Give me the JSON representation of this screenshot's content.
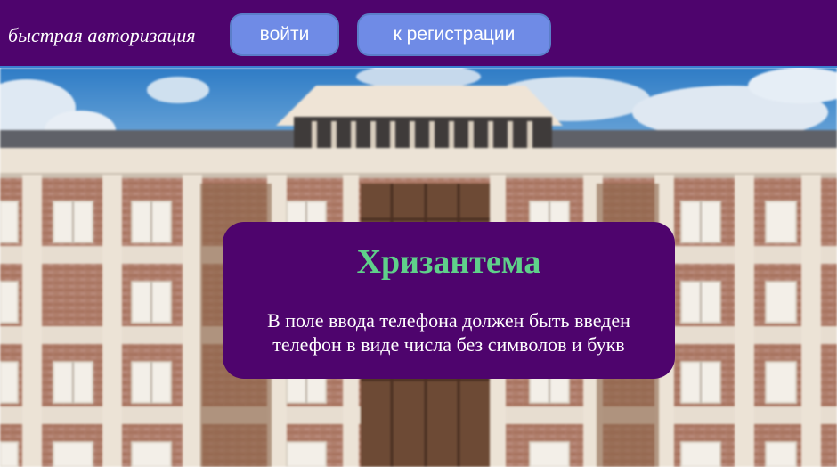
{
  "header": {
    "quick_auth_label": "быстрая авторизация",
    "login_button": "войти",
    "register_button": "к регистрации"
  },
  "card": {
    "title": "Хризантема",
    "message": "В поле ввода телефона должен быть введен телефон в виде числа без символов и букв"
  },
  "colors": {
    "brand_purple": "#4e046d",
    "button_blue": "#6f8be6",
    "title_green": "#5fd08a"
  },
  "background": {
    "image": "building-facade-photo"
  }
}
